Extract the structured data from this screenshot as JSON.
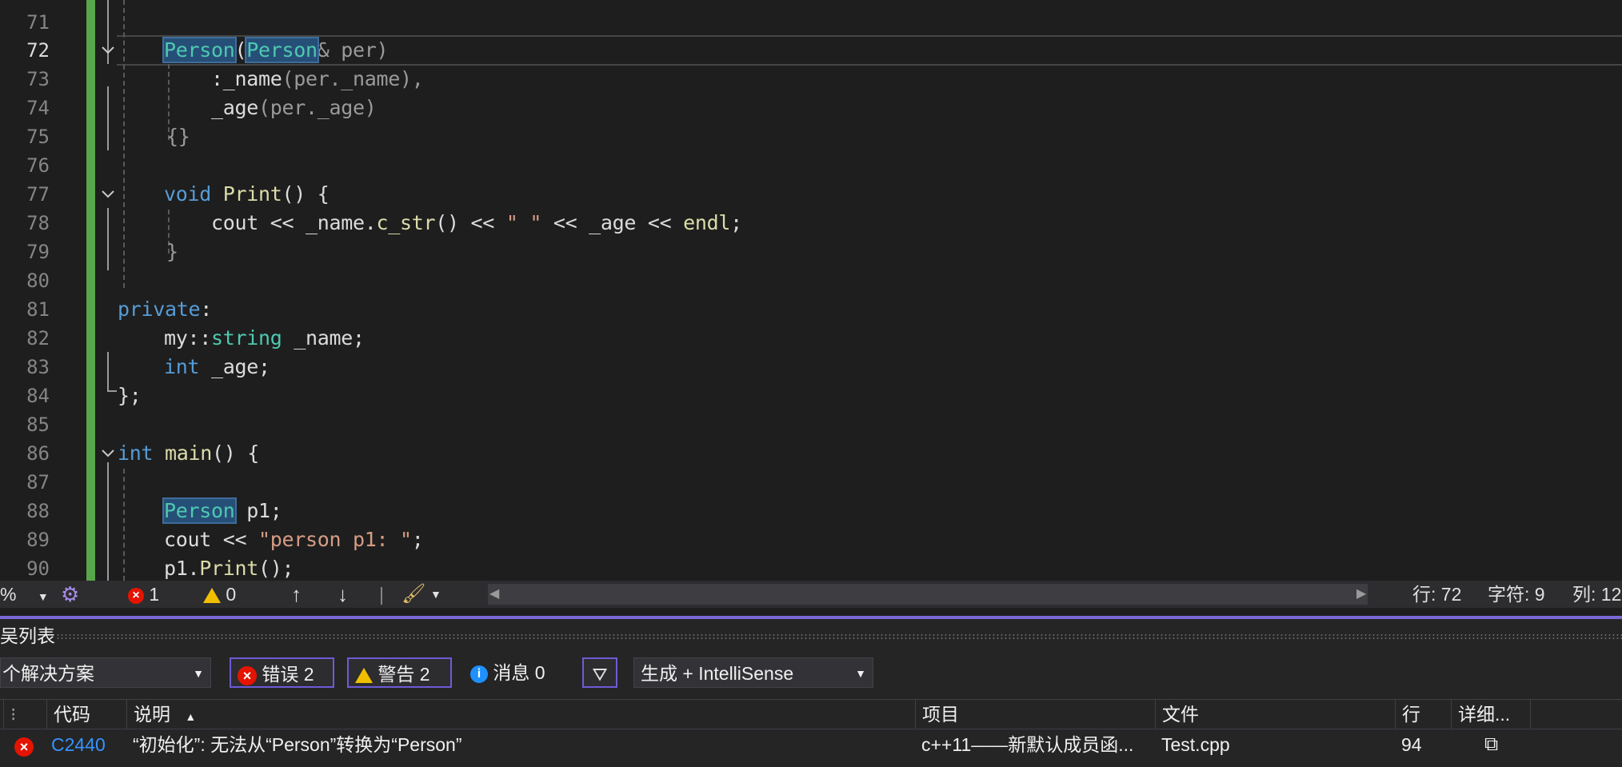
{
  "editor": {
    "lines": [
      {
        "num": "71"
      },
      {
        "num": "72"
      },
      {
        "num": "73"
      },
      {
        "num": "74"
      },
      {
        "num": "75"
      },
      {
        "num": "76"
      },
      {
        "num": "77"
      },
      {
        "num": "78"
      },
      {
        "num": "79"
      },
      {
        "num": "80"
      },
      {
        "num": "81"
      },
      {
        "num": "82"
      },
      {
        "num": "83"
      },
      {
        "num": "84"
      },
      {
        "num": "85"
      },
      {
        "num": "86"
      },
      {
        "num": "87"
      },
      {
        "num": "88"
      },
      {
        "num": "89"
      },
      {
        "num": "90"
      }
    ],
    "tokens": {
      "l72_person1": "Person",
      "l72_paren": "(",
      "l72_person2": "Person",
      "l72_rest": "& per)",
      "l73_colon": ":",
      "l73_name": "_name",
      "l73_args": "(per._name),",
      "l74_age": "_age",
      "l74_args": "(per._age)",
      "l75_braces": "{}",
      "l77_void": "void",
      "l77_print": "Print",
      "l77_rest": "() {",
      "l78_cout": "cout << _name.",
      "l78_cstr": "c_str",
      "l78_mid": "() << ",
      "l78_str": "\" \"",
      "l78_end": " << _age << ",
      "l78_endl": "endl",
      "l78_semi": ";",
      "l79_brace": "}",
      "l81_private": "private",
      "l81_colon": ":",
      "l82_my": "my::",
      "l82_string": "string",
      "l82_rest": " _name;",
      "l83_int": "int",
      "l83_rest": " _age;",
      "l84_close": "};",
      "l86_int": "int",
      "l86_main": "main",
      "l86_rest": "() {",
      "l88_person": "Person",
      "l88_rest": " p1;",
      "l89_cout": "cout << ",
      "l89_str": "\"person p1: \"",
      "l89_semi": ";",
      "l90_p1": "p1.",
      "l90_print": "Print",
      "l90_rest": "();"
    }
  },
  "status_strip": {
    "zoom": "%",
    "errors": "1",
    "warnings": "0",
    "line": "行: 72",
    "char": "字符: 9",
    "col": "列: 12"
  },
  "error_list": {
    "title": "吴列表",
    "scope": "个解决方案",
    "errors_btn": "错误 2",
    "warnings_btn": "警告 2",
    "messages_btn": "消息 0",
    "build_filter": "生成 + IntelliSense",
    "columns": {
      "code": "代码",
      "desc": "说明",
      "project": "项目",
      "file": "文件",
      "line": "行",
      "detail": "详细..."
    },
    "rows": [
      {
        "code": "C2440",
        "desc": "“初始化”: 无法从“Person”转换为“Person”",
        "project": "c++11——新默认成员函...",
        "file": "Test.cpp",
        "line": "94"
      }
    ]
  },
  "colors": {
    "background": "#1e1e1e",
    "keyword": "#569cd6",
    "type": "#4ec9b0",
    "function": "#dcdcaa",
    "string": "#d69d85",
    "change_bar": "#57a64a",
    "panel_accent": "#7b68d6",
    "error": "#e51400",
    "warning": "#f0c000"
  },
  "icons": [
    "chevron-down-icon",
    "error-icon",
    "warning-icon",
    "info-icon",
    "arrow-up-icon",
    "arrow-down-icon",
    "brush-icon",
    "filter-icon",
    "sort-ascending-icon",
    "browse-icon"
  ]
}
